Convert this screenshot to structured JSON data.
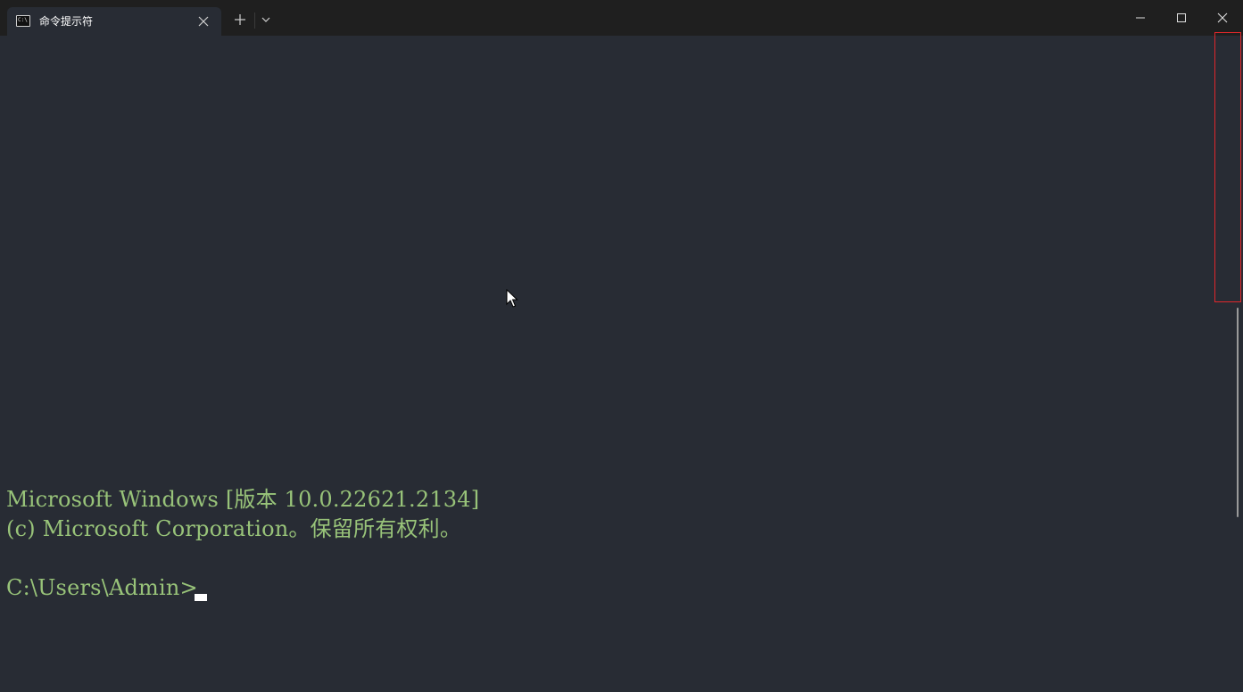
{
  "window": {
    "tab": {
      "icon": "cmd-icon",
      "icon_glyph": "C:\\",
      "title": "命令提示符"
    },
    "toolbar_icons": {
      "close_tab": "close-icon",
      "new_tab": "plus-icon",
      "dropdown": "chevron-down-icon",
      "minimize": "minimize-icon",
      "maximize": "maximize-icon",
      "close_window": "close-icon"
    }
  },
  "terminal": {
    "lines": [
      "Microsoft Windows [版本 10.0.22621.2134]",
      "(c) Microsoft Corporation。保留所有权利。",
      "C:\\Users\\Admin>"
    ],
    "text_color": "#98c379",
    "background": "#282c34"
  },
  "colors": {
    "titlebar": "#1f1f1f",
    "highlight": "#e0272b"
  }
}
